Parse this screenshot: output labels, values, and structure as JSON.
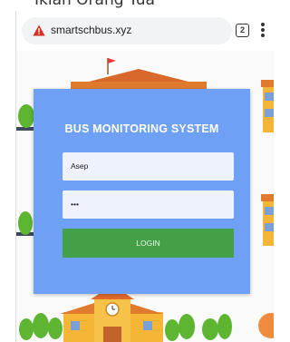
{
  "top_text": "Iklan Orang Tua",
  "browser": {
    "url": "smartschbus.xyz",
    "tab_count": "2",
    "icons": {
      "security": "warning-triangle-icon",
      "menu": "more-vert-icon"
    },
    "colors": {
      "warning": "#d93025"
    }
  },
  "login": {
    "title": "BUS MONITORING SYSTEM",
    "username_value": "Asep",
    "password_value": "•••",
    "button_label": "LOGIN",
    "colors": {
      "card": "#6ea1f5",
      "button": "#43a047",
      "field": "#eef2fd"
    }
  }
}
